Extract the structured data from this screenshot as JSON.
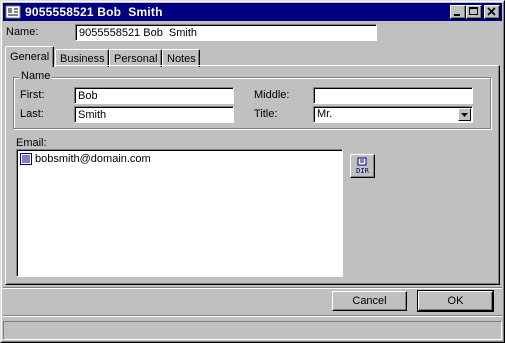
{
  "window": {
    "title": "9055558521 Bob  Smith",
    "icon": "contact-card-icon",
    "controls": {
      "minimize": "minimize-icon",
      "maximize": "maximize-icon",
      "close": "close-icon"
    }
  },
  "name_field": {
    "label": "Name:",
    "value": "9055558521 Bob  Smith"
  },
  "tabs": [
    {
      "label": "General",
      "active": true
    },
    {
      "label": "Business",
      "active": false
    },
    {
      "label": "Personal",
      "active": false
    },
    {
      "label": "Notes",
      "active": false
    }
  ],
  "name_group": {
    "legend": "Name",
    "first": {
      "label": "First:",
      "value": "Bob"
    },
    "last": {
      "label": "Last:",
      "value": "Smith"
    },
    "middle": {
      "label": "Middle:",
      "value": ""
    },
    "title": {
      "label": "Title:",
      "value": "Mr."
    }
  },
  "email": {
    "label": "Email:",
    "items": [
      {
        "address": "bobsmith@domain.com",
        "icon": "email-entry-icon"
      }
    ],
    "dir_button": {
      "label": "DIR",
      "icon": "directory-icon"
    }
  },
  "buttons": {
    "cancel": "Cancel",
    "ok": "OK"
  },
  "colors": {
    "face": "#c0c0c0",
    "titlebar": "#000080",
    "field": "#ffffff"
  }
}
